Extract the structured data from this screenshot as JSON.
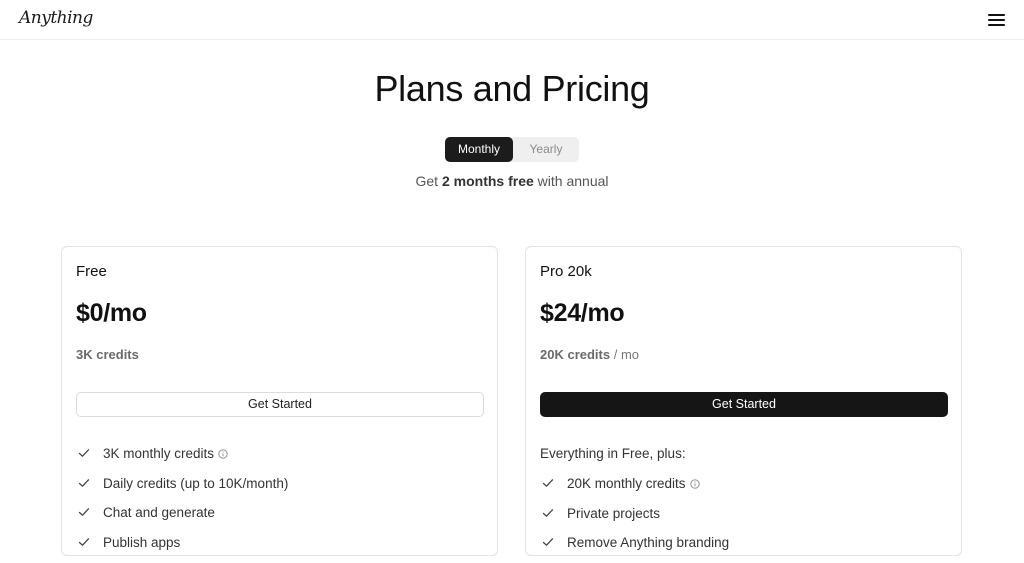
{
  "header": {
    "logo_text": "Anything",
    "menu_icon": "hamburger-menu-icon"
  },
  "hero": {
    "title": "Plans and Pricing",
    "toggle": {
      "monthly_label": "Monthly",
      "yearly_label": "Yearly",
      "selected": "Monthly"
    },
    "annual_note_prefix": "Get ",
    "annual_note_bold": "2 months free",
    "annual_note_suffix": " with annual"
  },
  "plans": [
    {
      "name": "Free",
      "price": "$0/mo",
      "credits": "3K credits",
      "credits_suffix": "",
      "cta_label": "Get Started",
      "features_intro": "",
      "features": [
        "3K monthly credits",
        "Daily credits (up to 10K/month)",
        "Chat and generate",
        "Publish apps"
      ]
    },
    {
      "name": "Pro 20k",
      "price": "$24/mo",
      "credits": "20K credits",
      "credits_suffix": "/ mo",
      "cta_label": "Get Started",
      "features_intro": "Everything in Free, plus:",
      "features": [
        "20K monthly credits",
        "Private projects",
        "Remove Anything branding"
      ]
    }
  ],
  "colors": {
    "accent_dark": "#151515",
    "toggle_bg": "#efefef",
    "border": "#e3e3e3",
    "muted_text": "#666666"
  }
}
